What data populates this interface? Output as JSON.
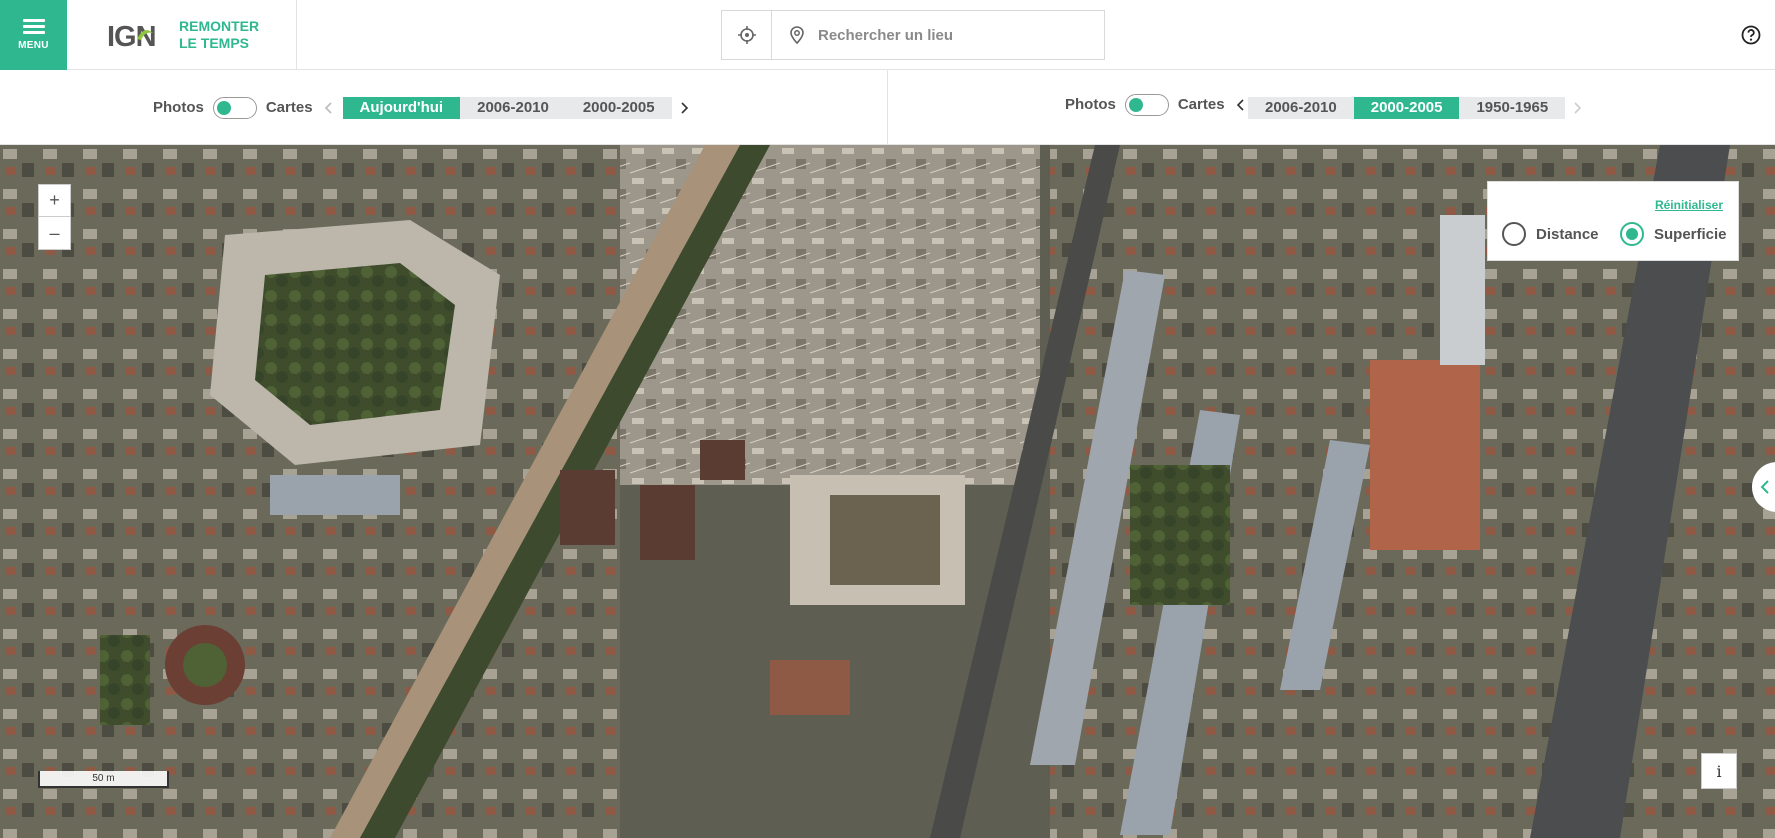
{
  "header": {
    "menu_label": "MENU",
    "logo_text": "IGN",
    "brand_line1": "REMONTER",
    "brand_line2": "LE TEMPS",
    "search_placeholder": "Rechercher un lieu",
    "icons": [
      "menu-icon",
      "crosshair-icon",
      "map-pin-icon",
      "help-icon"
    ]
  },
  "left_bar": {
    "photos_label": "Photos",
    "cartes_label": "Cartes",
    "years": [
      "Aujourd'hui",
      "2006-2010",
      "2000-2005"
    ],
    "active_year": "Aujourd'hui"
  },
  "right_bar": {
    "photos_label": "Photos",
    "cartes_label": "Cartes",
    "years": [
      "2006-2010",
      "2000-2005",
      "1950-1965"
    ],
    "active_year": "2000-2005"
  },
  "map": {
    "zoom_in": "+",
    "zoom_out": "–",
    "scale_label": "50 m",
    "info_label": "i",
    "measure": {
      "reset_label": "Réinitialiser",
      "distance_label": "Distance",
      "area_label": "Superficie",
      "selected": "Superficie"
    }
  },
  "colors": {
    "accent": "#2fb88f",
    "border": "#e3e3e3",
    "year_bg": "#e7e9eb"
  }
}
